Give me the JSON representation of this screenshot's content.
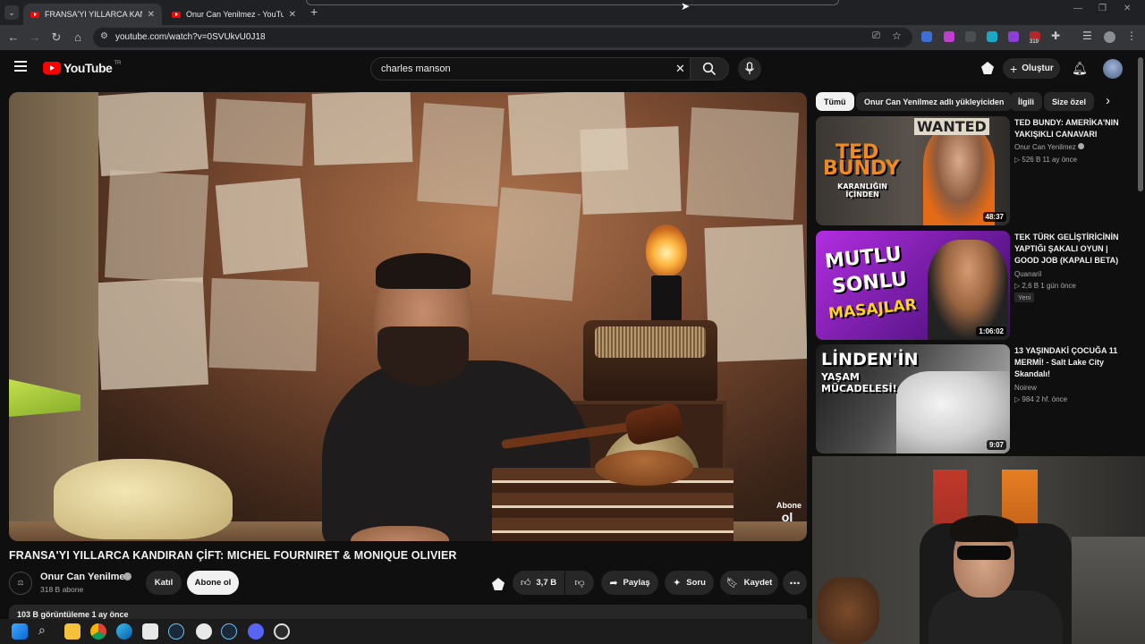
{
  "browser": {
    "tabs": [
      {
        "title": "FRANSA'YI YILLARCA KANDIRAN",
        "active": true
      },
      {
        "title": "Onur Can Yenilmez - YouTube",
        "active": false
      }
    ],
    "new_tab": "+",
    "url": "youtube.com/watch?v=0SVUkvU0J18",
    "extension_badge": "319"
  },
  "masthead": {
    "logo_text": "YouTube",
    "logo_region": "TR",
    "search_value": "charles manson",
    "create_label": "Oluştur"
  },
  "video": {
    "title": "FRANSA'YI YILLARCA KANDIRAN ÇİFT: MICHEL FOURNIRET & MONIQUE OLIVIER",
    "watermark_top": "Abone",
    "watermark_bottom": "ol",
    "channel_name": "Onur Can Yenilmez",
    "subscribers": "318 B abone",
    "join_label": "Katıl",
    "subscribe_label": "Abone ol",
    "likes": "3,7 B",
    "share_label": "Paylaş",
    "ask_label": "Soru",
    "save_label": "Kaydet",
    "stats": "103 B görüntüleme  1 ay önce"
  },
  "chips": [
    {
      "label": "Tümü",
      "selected": true
    },
    {
      "label": "Onur Can Yenilmez adlı yükleyiciden",
      "selected": false
    },
    {
      "label": "İlgili",
      "selected": false
    },
    {
      "label": "Size özel",
      "selected": false
    }
  ],
  "recommendations": [
    {
      "title": "TED BUNDY: AMERİKA'NIN YAKIŞIKLI CANAVARI",
      "channel": "Onur Can Yenilmez",
      "meta": "526 B   11 ay önce",
      "duration": "48:37",
      "thumb_text_1": "TED",
      "thumb_text_2": "BUNDY",
      "thumb_text_3": "KARANLIĞIN İÇİNDEN",
      "thumb_text_4": "WANTED",
      "colors": {
        "bg": "#2a2a2a",
        "accent": "#f08a1c"
      }
    },
    {
      "title": "TEK TÜRK GELİŞTİRİCİNİN YAPTIĞI ŞAKALI OYUN | GOOD JOB (KAPALI BETA)",
      "channel": "Quanaril",
      "meta": "2,6 B   1 gün önce",
      "badge": "Yeni",
      "duration": "1:06:02",
      "thumb_text_1": "MUTLU",
      "thumb_text_2": "SONLU",
      "thumb_text_3": "MASAJLAR",
      "colors": {
        "bg": "#8a1fb0",
        "accent": "#ffd21a"
      }
    },
    {
      "title": "13 YAŞINDAKİ ÇOCUĞA 11 MERMİ! - Salt Lake City Skandalı!",
      "channel": "Noirew",
      "meta": "984   2 hf. önce",
      "duration": "9:07",
      "thumb_text_1": "LİNDEN'İN",
      "thumb_text_2": "YAŞAM MÜCADELESİ!",
      "colors": {
        "bg": "#3a3a3a",
        "accent": "#ffffff"
      }
    }
  ]
}
